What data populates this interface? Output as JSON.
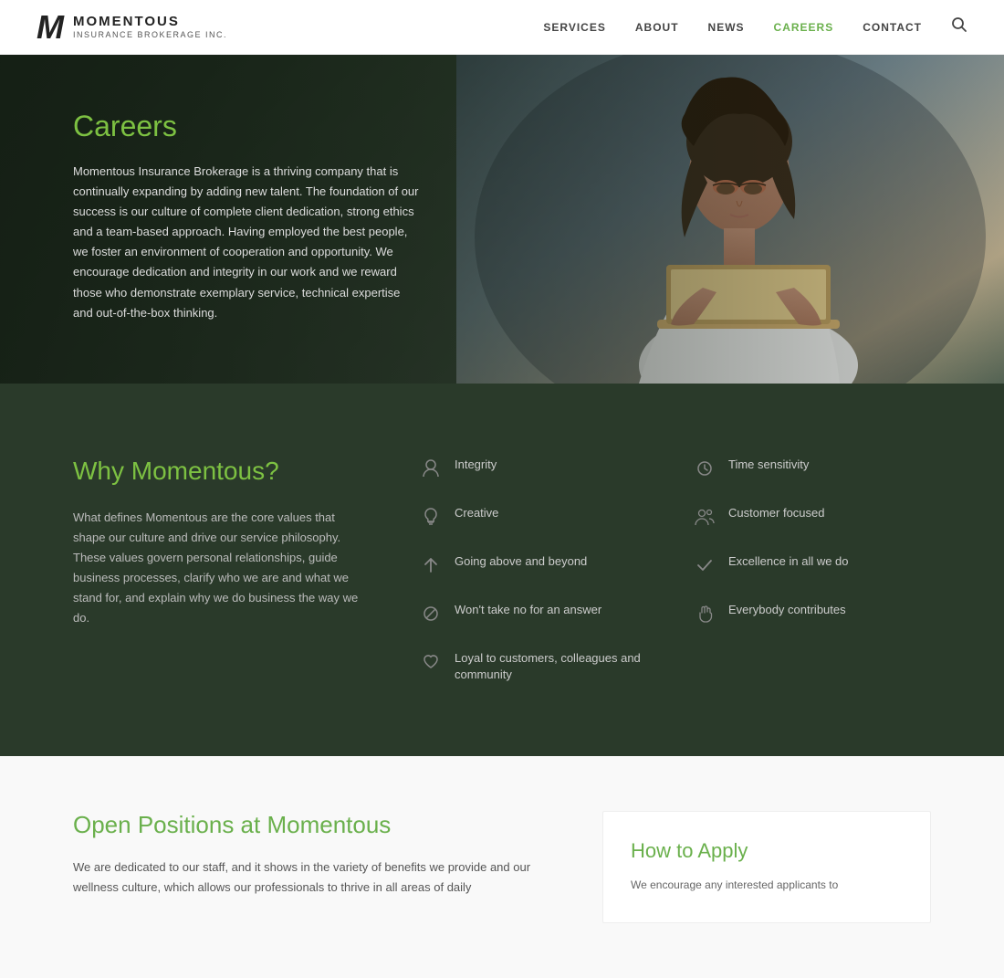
{
  "header": {
    "logo_m": "M",
    "logo_name": "MOMENTOUS",
    "logo_sub": "INSURANCE BROKERAGE INC.",
    "nav": [
      {
        "id": "services",
        "label": "SERVICES",
        "active": false
      },
      {
        "id": "about",
        "label": "ABOUT",
        "active": false
      },
      {
        "id": "news",
        "label": "NEWS",
        "active": false
      },
      {
        "id": "careers",
        "label": "CAREERS",
        "active": true
      },
      {
        "id": "contact",
        "label": "CONTACT",
        "active": false
      }
    ]
  },
  "hero": {
    "title": "Careers",
    "body": "Momentous Insurance Brokerage is a thriving company that is continually expanding by adding new talent. The foundation of our success is our culture of complete client dedication, strong ethics and a team-based approach. Having employed the best people, we foster an environment of cooperation and opportunity. We encourage dedication and integrity in our work and we reward those who demonstrate exemplary service, technical expertise and out-of-the-box thinking."
  },
  "why": {
    "title": "Why Momentous?",
    "body": "What defines Momentous are the core values that shape our culture and drive our service philosophy. These values govern personal relationships, guide business processes, clarify who we are and what we stand for, and explain why we do business the way we do.",
    "values_left": [
      {
        "icon": "person",
        "label": "Integrity"
      },
      {
        "icon": "bulb",
        "label": "Creative"
      },
      {
        "icon": "arrow",
        "label": "Going above and beyond"
      },
      {
        "icon": "no",
        "label": "Won't take no for an answer"
      },
      {
        "icon": "heart",
        "label": "Loyal to customers, colleagues and community"
      }
    ],
    "values_right": [
      {
        "icon": "clock",
        "label": "Time sensitivity"
      },
      {
        "icon": "people",
        "label": "Customer focused"
      },
      {
        "icon": "check",
        "label": "Excellence in all we do"
      },
      {
        "icon": "hand",
        "label": "Everybody contributes"
      }
    ]
  },
  "open": {
    "title": "Open Positions at Momentous",
    "body": "We are dedicated to our staff, and it shows in the variety of benefits we provide and our wellness culture, which allows our professionals to thrive in all areas of daily"
  },
  "how_apply": {
    "title": "How to Apply",
    "body": "We encourage any interested applicants to"
  }
}
